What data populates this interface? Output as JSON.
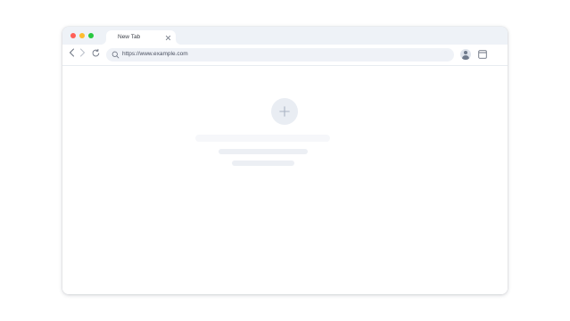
{
  "window": {
    "controls": [
      "close",
      "minimize",
      "maximize"
    ],
    "colors": {
      "close": "#ff5f57",
      "minimize": "#febc2e",
      "maximize": "#28c840"
    }
  },
  "tabs": [
    {
      "title": "New Tab",
      "active": true,
      "close_icon": "close-icon"
    }
  ],
  "toolbar": {
    "back_icon": "chevron-left-icon",
    "forward_icon": "chevron-right-icon",
    "reload_icon": "reload-icon",
    "profile_icon": "profile-avatar-icon",
    "window_icon": "window-icon"
  },
  "address_bar": {
    "icon": "search-icon",
    "url": "https://www.example.com"
  },
  "new_tab_page": {
    "add_icon": "plus-icon",
    "placeholder_lines": 3
  }
}
